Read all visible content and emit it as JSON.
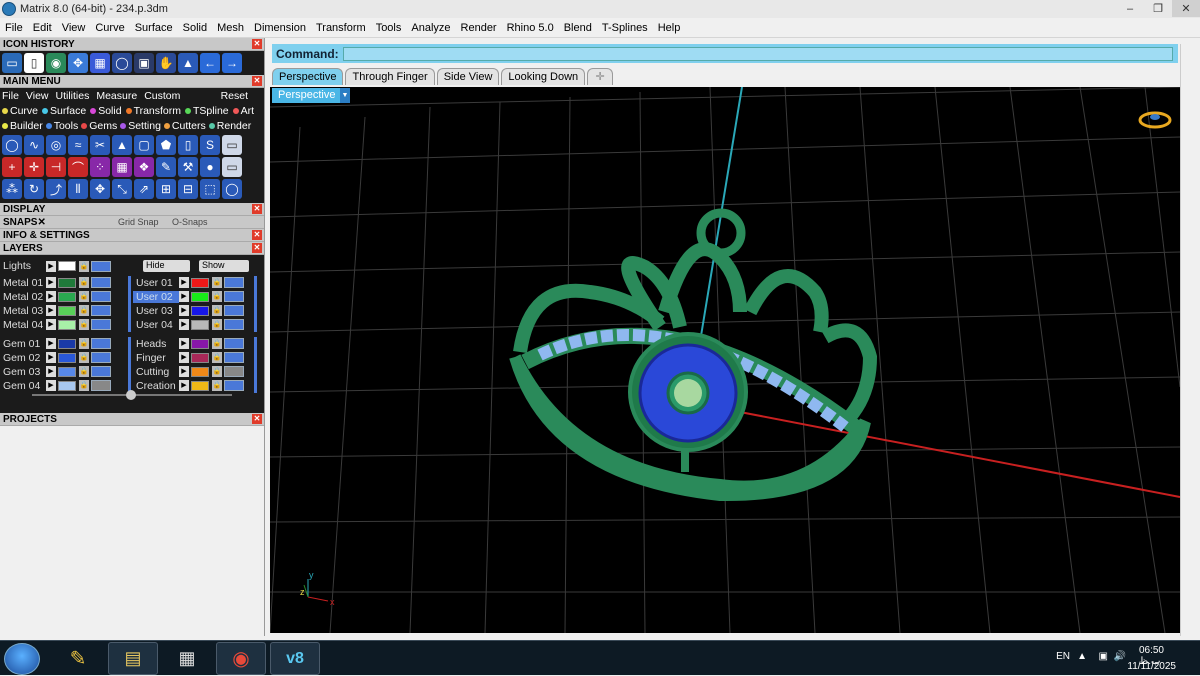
{
  "window": {
    "title": "Matrix 8.0 (64-bit) - 234.p.3dm",
    "buttons": [
      "–",
      "❐",
      "✕"
    ]
  },
  "menubar": [
    "File",
    "Edit",
    "View",
    "Curve",
    "Surface",
    "Solid",
    "Mesh",
    "Dimension",
    "Transform",
    "Tools",
    "Analyze",
    "Render",
    "Rhino 5.0",
    "Blend",
    "T-Splines",
    "Help"
  ],
  "left_panel": {
    "icon_history": "ICON HISTORY",
    "main_menu": "MAIN MENU",
    "main_menu_items": [
      "File",
      "View",
      "Utilities",
      "Measure",
      "Custom"
    ],
    "reset": "Reset",
    "categories_row1": [
      {
        "label": "Curve",
        "color": "#e8d84a"
      },
      {
        "label": "Surface",
        "color": "#48c8e8"
      },
      {
        "label": "Solid",
        "color": "#d848d8"
      },
      {
        "label": "Transform",
        "color": "#f07828"
      },
      {
        "label": "TSpline",
        "color": "#58d858"
      },
      {
        "label": "Art",
        "color": "#f05858"
      }
    ],
    "categories_row2": [
      {
        "label": "Builder",
        "color": "#e8e848"
      },
      {
        "label": "Tools",
        "color": "#4888e8"
      },
      {
        "label": "Gems",
        "color": "#e84848"
      },
      {
        "label": "Setting",
        "color": "#a858e8"
      },
      {
        "label": "Cutters",
        "color": "#f0a040"
      },
      {
        "label": "Render",
        "color": "#58c8a8"
      }
    ],
    "display": "DISPLAY",
    "snaps": "SNAPS",
    "grid_snap": "Grid Snap",
    "o_snaps": "O-Snaps",
    "info_settings": "INFO & SETTINGS",
    "layers": "LAYERS",
    "lights": "Lights",
    "hide": "Hide",
    "show": "Show",
    "layers_left": [
      {
        "name": "Metal 01",
        "color": "#1f7a3a"
      },
      {
        "name": "Metal 02",
        "color": "#2aa850"
      },
      {
        "name": "Metal 03",
        "color": "#58d058"
      },
      {
        "name": "Metal 04",
        "color": "#a8f0a8"
      },
      {
        "name": "Gem 01",
        "color": "#1a3aa8"
      },
      {
        "name": "Gem 02",
        "color": "#2a58d8"
      },
      {
        "name": "Gem 03",
        "color": "#5888e8"
      },
      {
        "name": "Gem 04",
        "color": "#a8c8f0"
      }
    ],
    "layers_right": [
      {
        "name": "User 01",
        "color": "#f01818"
      },
      {
        "name": "User 02",
        "color": "#18e818"
      },
      {
        "name": "User 03",
        "color": "#1818e8"
      },
      {
        "name": "User 04",
        "color": "#b8b8b8"
      },
      {
        "name": "Heads",
        "color": "#8818a8"
      },
      {
        "name": "Finger",
        "color": "#a82858"
      },
      {
        "name": "Cutting",
        "color": "#f08818"
      },
      {
        "name": "Creation",
        "color": "#f0b818"
      }
    ],
    "projects": "PROJECTS"
  },
  "command": {
    "label": "Command:",
    "value": ""
  },
  "tabs": [
    "Perspective",
    "Through Finger",
    "Side View",
    "Looking Down"
  ],
  "viewport_label": "Perspective",
  "axis": {
    "y": "y",
    "x": "x",
    "z": "z"
  },
  "taskbar": {
    "lang": "EN",
    "time": "06:50 ب.ظ",
    "date": "11/11/2025"
  }
}
